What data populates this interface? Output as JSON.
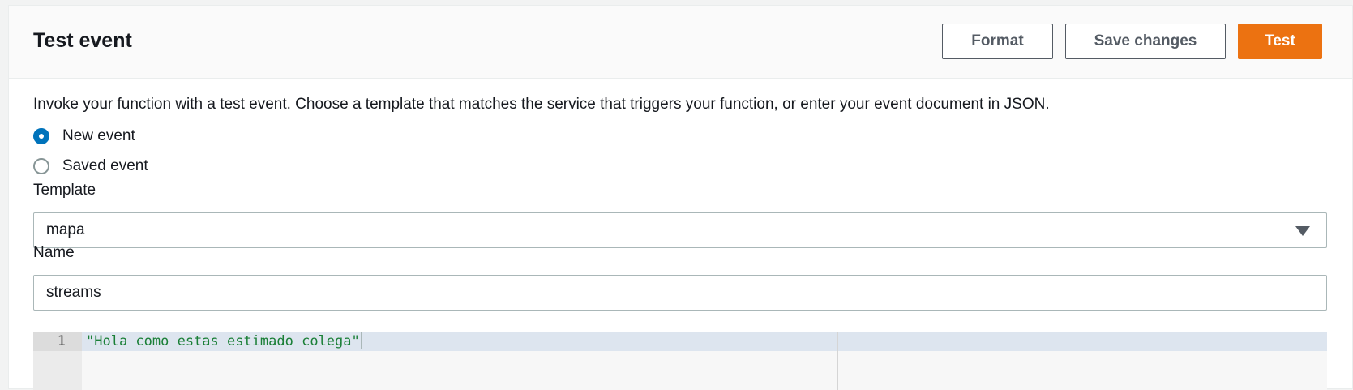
{
  "header": {
    "title": "Test event",
    "format_label": "Format",
    "save_label": "Save changes",
    "test_label": "Test"
  },
  "description": "Invoke your function with a test event. Choose a template that matches the service that triggers your function, or enter your event document in JSON.",
  "event_type": {
    "options": [
      {
        "label": "New event",
        "selected": true
      },
      {
        "label": "Saved event",
        "selected": false
      }
    ]
  },
  "template": {
    "label": "Template",
    "value": "mapa"
  },
  "name": {
    "label": "Name",
    "value": "streams"
  },
  "editor": {
    "lines": [
      {
        "number": "1",
        "text": "\"Hola como estas estimado colega\""
      }
    ]
  },
  "colors": {
    "primary_button": "#ec7211",
    "radio_selected": "#0073bb",
    "code_string": "#1a7f37"
  }
}
